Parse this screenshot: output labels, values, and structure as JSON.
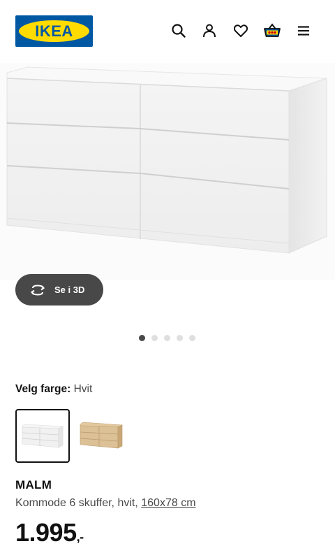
{
  "header": {
    "logo_text": "IKEA",
    "icons": [
      "search-icon",
      "user-icon",
      "heart-icon",
      "shopping-basket-icon",
      "menu-icon"
    ]
  },
  "gallery": {
    "view_3d_label": "Se i 3D",
    "dot_count": 5,
    "active_dot": 1
  },
  "color": {
    "label": "Velg farge:",
    "value": "Hvit",
    "options": [
      {
        "name": "white",
        "selected": true
      },
      {
        "name": "oak-veneer",
        "selected": false
      }
    ]
  },
  "product": {
    "name": "MALM",
    "description": "Kommode 6 skuffer, hvit,",
    "dimensions": "160x78 cm",
    "price": "1.995",
    "price_suffix": ",-"
  },
  "colors": {
    "ikea_blue": "#0058a3",
    "ikea_yellow": "#ffdb00",
    "button_dark": "#484848",
    "text": "#111111"
  }
}
